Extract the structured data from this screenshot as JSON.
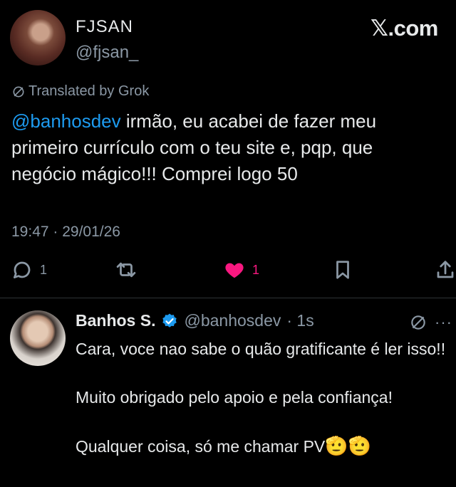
{
  "brand": "𝕏.com",
  "tweet": {
    "author_name": "FJSAN",
    "author_handle": "@fjsan_",
    "translated_label": "Translated by Grok",
    "mention": "@banhosdev",
    "text": " irmão, eu acabei de fazer meu primeiro currículo com o teu site e, pqp, que negócio mágico!!! Comprei logo 50",
    "timestamp": "19:47 · 29/01/26",
    "replies": "1",
    "likes": "1"
  },
  "reply": {
    "author_name": "Banhos S.",
    "author_handle": "@banhosdev",
    "time": "· 1s",
    "more": "···",
    "line1": "Cara, voce nao sabe o quão gratificante é ler isso!!",
    "line2": "Muito obrigado pelo apoio e pela confiança!",
    "line3": "Qualquer coisa, só me chamar PV",
    "emoji": "🫡🫡"
  },
  "colors": {
    "background": "#000000",
    "text": "#e7e9ea",
    "secondary": "#8b98a5",
    "link": "#1d9bf0",
    "like": "#f91880",
    "verified": "#1d9bf0"
  },
  "icons": [
    "translate-icon",
    "reply-icon",
    "retweet-icon",
    "like-icon",
    "bookmark-icon",
    "share-icon",
    "verified-badge-icon",
    "more-icon"
  ]
}
